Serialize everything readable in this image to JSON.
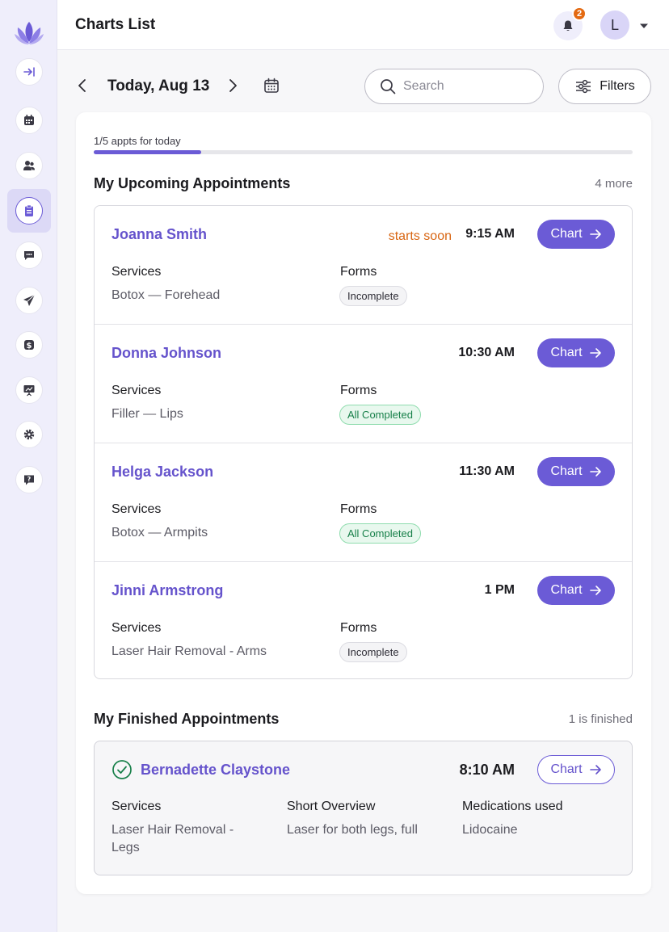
{
  "header": {
    "title": "Charts List",
    "notification_count": "2",
    "avatar_initial": "L"
  },
  "sidebar": {
    "items": [
      {
        "name": "collapse",
        "icon": "collapse-icon"
      },
      {
        "name": "calendar",
        "icon": "calendar-icon"
      },
      {
        "name": "clients",
        "icon": "users-icon"
      },
      {
        "name": "charts",
        "icon": "clipboard-icon",
        "active": true
      },
      {
        "name": "messages",
        "icon": "chat-icon"
      },
      {
        "name": "marketing",
        "icon": "send-icon"
      },
      {
        "name": "payments",
        "icon": "dollar-icon"
      },
      {
        "name": "reports",
        "icon": "presentation-icon"
      },
      {
        "name": "settings",
        "icon": "gear-icon"
      },
      {
        "name": "help",
        "icon": "help-icon"
      }
    ]
  },
  "date_nav": {
    "label": "Today, Aug 13"
  },
  "search": {
    "placeholder": "Search",
    "value": ""
  },
  "filters": {
    "label": "Filters"
  },
  "progress": {
    "label": "1/5 appts for today",
    "completed": 1,
    "total": 5
  },
  "upcoming": {
    "title": "My Upcoming Appointments",
    "meta": "4 more",
    "services_label": "Services",
    "forms_label": "Forms",
    "chart_label": "Chart",
    "appointments": [
      {
        "name": "Joanna Smith",
        "status": "starts soon",
        "time": "9:15 AM",
        "service": "Botox — Forehead",
        "forms": "Incomplete",
        "forms_state": "incomplete"
      },
      {
        "name": "Donna Johnson",
        "status": "",
        "time": "10:30 AM",
        "service": "Filler — Lips",
        "forms": "All Completed",
        "forms_state": "complete"
      },
      {
        "name": "Helga Jackson",
        "status": "",
        "time": "11:30 AM",
        "service": "Botox — Armpits",
        "forms": "All Completed",
        "forms_state": "complete"
      },
      {
        "name": "Jinni Armstrong",
        "status": "",
        "time": "1 PM",
        "service": "Laser Hair Removal - Arms",
        "forms": "Incomplete",
        "forms_state": "incomplete"
      }
    ]
  },
  "finished": {
    "title": "My Finished Appointments",
    "meta": "1 is finished",
    "appointment": {
      "name": "Bernadette Claystone",
      "time": "8:10 AM",
      "chart_label": "Chart",
      "services_label": "Services",
      "services_value": "Laser Hair Removal - Legs",
      "overview_label": "Short Overview",
      "overview_value": "Laser for both legs, full",
      "medications_label": "Medications used",
      "medications_value": "Lidocaine"
    }
  },
  "colors": {
    "accent": "#6b5bd6",
    "name": "#6553cc",
    "warning": "#d86512",
    "success": "#18804a"
  }
}
